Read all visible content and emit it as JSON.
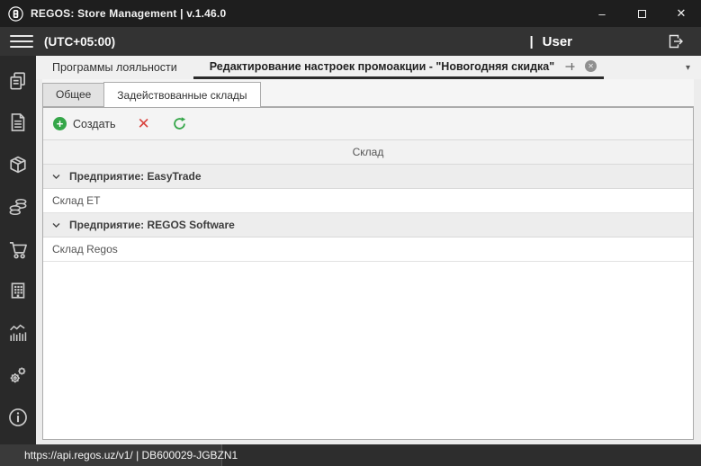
{
  "window": {
    "title": "REGOS: Store Management | v.1.46.0",
    "controls": {
      "minimize": "–",
      "close": "✕"
    }
  },
  "header": {
    "timezone": "(UTC+05:00)",
    "user_separator": "|",
    "user": "User"
  },
  "sidebar": {
    "items": [
      "pages-icon",
      "document-icon",
      "package-icon",
      "coins-icon",
      "cart-icon",
      "building-icon",
      "stats-icon",
      "gears-icon",
      "info-icon"
    ]
  },
  "document_tabs": {
    "tabs": [
      {
        "label": "Программы лояльности",
        "active": false
      },
      {
        "label": "Редактирование настроек промоакции - \"Новогодняя скидка\"",
        "active": true
      }
    ],
    "close_glyph": "✕",
    "dropdown_glyph": "▾"
  },
  "sub_tabs": [
    {
      "label": "Общее",
      "active": false
    },
    {
      "label": "Задействованные склады",
      "active": true
    }
  ],
  "toolbar": {
    "create_label": "Создать",
    "create_glyph": "+",
    "delete_glyph": "✕"
  },
  "grid": {
    "column_header": "Склад",
    "groups": [
      {
        "label": "Предприятие: EasyTrade",
        "rows": [
          "Склад ET"
        ]
      },
      {
        "label": "Предприятие: REGOS Software",
        "rows": [
          "Склад Regos"
        ]
      }
    ]
  },
  "status_bar": {
    "endpoint": "https://api.regos.uz/v1/ | DB600029-JGBZN1"
  },
  "colors": {
    "accent_green": "#35a649",
    "danger_red": "#d9443e",
    "titlebar": "#1e1e1e",
    "header": "#333333",
    "sidebar": "#292929",
    "statusbar": "#2d2d2d"
  }
}
